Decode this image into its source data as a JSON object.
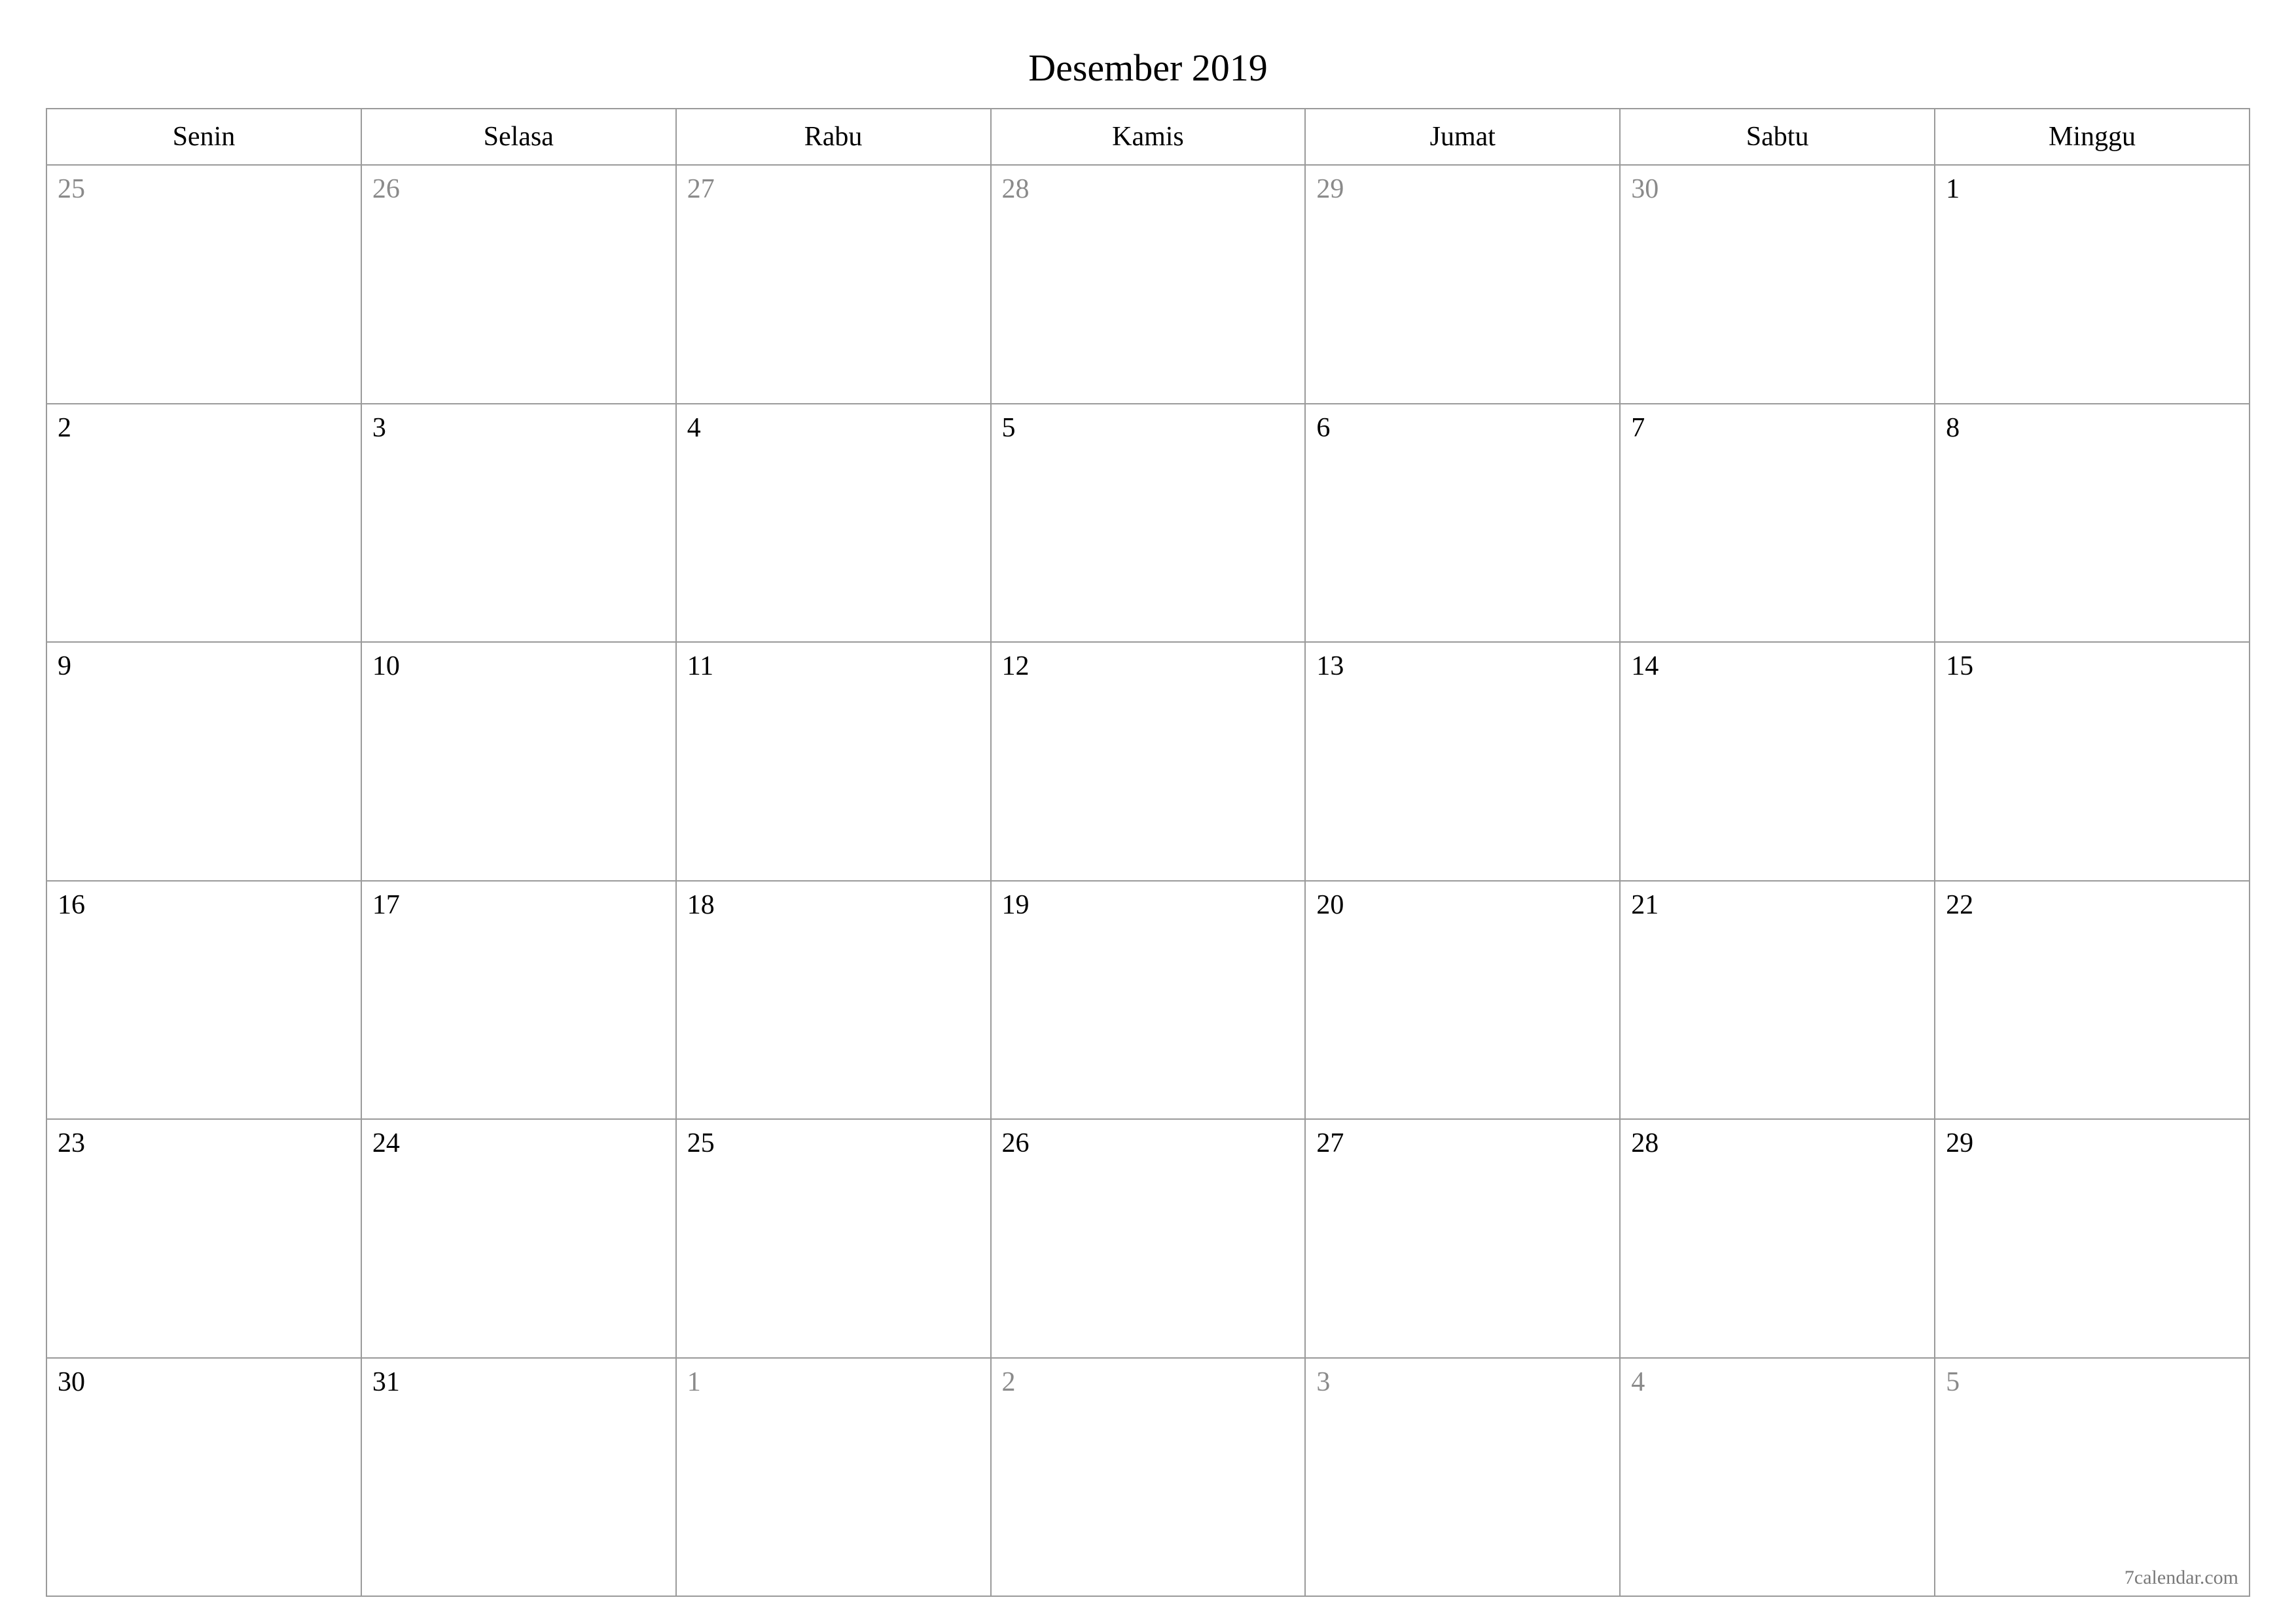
{
  "title": "Desember 2019",
  "weekdays": [
    "Senin",
    "Selasa",
    "Rabu",
    "Kamis",
    "Jumat",
    "Sabtu",
    "Minggu"
  ],
  "weeks": [
    [
      {
        "day": "25",
        "other": true
      },
      {
        "day": "26",
        "other": true
      },
      {
        "day": "27",
        "other": true
      },
      {
        "day": "28",
        "other": true
      },
      {
        "day": "29",
        "other": true
      },
      {
        "day": "30",
        "other": true
      },
      {
        "day": "1",
        "other": false
      }
    ],
    [
      {
        "day": "2",
        "other": false
      },
      {
        "day": "3",
        "other": false
      },
      {
        "day": "4",
        "other": false
      },
      {
        "day": "5",
        "other": false
      },
      {
        "day": "6",
        "other": false
      },
      {
        "day": "7",
        "other": false
      },
      {
        "day": "8",
        "other": false
      }
    ],
    [
      {
        "day": "9",
        "other": false
      },
      {
        "day": "10",
        "other": false
      },
      {
        "day": "11",
        "other": false
      },
      {
        "day": "12",
        "other": false
      },
      {
        "day": "13",
        "other": false
      },
      {
        "day": "14",
        "other": false
      },
      {
        "day": "15",
        "other": false
      }
    ],
    [
      {
        "day": "16",
        "other": false
      },
      {
        "day": "17",
        "other": false
      },
      {
        "day": "18",
        "other": false
      },
      {
        "day": "19",
        "other": false
      },
      {
        "day": "20",
        "other": false
      },
      {
        "day": "21",
        "other": false
      },
      {
        "day": "22",
        "other": false
      }
    ],
    [
      {
        "day": "23",
        "other": false
      },
      {
        "day": "24",
        "other": false
      },
      {
        "day": "25",
        "other": false
      },
      {
        "day": "26",
        "other": false
      },
      {
        "day": "27",
        "other": false
      },
      {
        "day": "28",
        "other": false
      },
      {
        "day": "29",
        "other": false
      }
    ],
    [
      {
        "day": "30",
        "other": false
      },
      {
        "day": "31",
        "other": false
      },
      {
        "day": "1",
        "other": true
      },
      {
        "day": "2",
        "other": true
      },
      {
        "day": "3",
        "other": true
      },
      {
        "day": "4",
        "other": true
      },
      {
        "day": "5",
        "other": true
      }
    ]
  ],
  "footer": "7calendar.com"
}
